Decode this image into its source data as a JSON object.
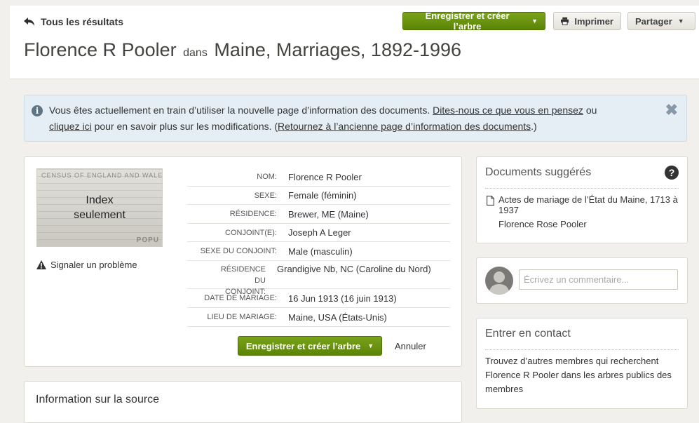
{
  "header": {
    "back_label": "Tous les résultats",
    "title_name": "Florence R Pooler",
    "title_connector": "dans",
    "title_collection": "Maine, Marriages, 1892-1996",
    "save_tree_label": "Enregistrer et créer l’arbre",
    "print_label": "Imprimer",
    "share_label": "Partager"
  },
  "banner": {
    "text_1": "Vous êtes actuellement en train d’utiliser la nouvelle page d’information des documents.",
    "link_feedback": "Dites-nous ce que vous en pensez",
    "text_2": "ou",
    "link_click_here": "cliquez ici",
    "text_3": "pour en savoir plus sur les modifications. (",
    "link_old_page": "Retournez à l’ancienne page d’information des documents",
    "text_4": ".)"
  },
  "record": {
    "thumbnail": {
      "label_line1": "Index",
      "label_line2": "seulement",
      "census_text": "CENSUS OF ENGLAND AND WALES,",
      "popu_text": "POPU"
    },
    "report_problem": "Signaler un problème",
    "fields": [
      {
        "label": "NOM:",
        "value": "Florence R Pooler"
      },
      {
        "label": "SEXE:",
        "value": "Female (féminin)"
      },
      {
        "label": "RÉSIDENCE:",
        "value": "Brewer, ME (Maine)"
      },
      {
        "label": "CONJOINT(E):",
        "value": "Joseph A Leger"
      },
      {
        "label": "SEXE DU CONJOINT:",
        "value": "Male (masculin)"
      },
      {
        "label": "RÉSIDENCE DU CONJOINT:",
        "value": "Grandigive Nb, NC (Caroline du Nord)"
      },
      {
        "label": "DATE DE MARIAGE:",
        "value": "16 Jun 1913 (16 juin 1913)"
      },
      {
        "label": "LIEU DE MARIAGE:",
        "value": "Maine, USA (États-Unis)"
      }
    ],
    "save_tree_label": "Enregistrer et créer l’arbre",
    "cancel_label": "Annuler"
  },
  "source": {
    "title": "Information sur la source"
  },
  "suggested": {
    "title": "Documents suggérés",
    "item_title": "Actes de mariage de l’État du Maine, 1713 à 1937",
    "item_person": "Florence Rose Pooler"
  },
  "comment": {
    "placeholder": "Écrivez un commentaire..."
  },
  "contact": {
    "title": "Entrer en contact",
    "text": "Trouvez d’autres membres qui recherchent Florence R Pooler dans les arbres publics des membres"
  },
  "colors": {
    "accent_green": "#6a950f",
    "banner_bg": "#e5eef4",
    "page_bg": "#f1f0ec"
  },
  "icons": {
    "back": "reply-arrow-icon",
    "print": "printer-icon",
    "info": "info-icon",
    "close": "close-icon",
    "warning": "warning-icon",
    "help": "help-icon",
    "document": "document-icon",
    "avatar": "user-avatar-icon"
  }
}
